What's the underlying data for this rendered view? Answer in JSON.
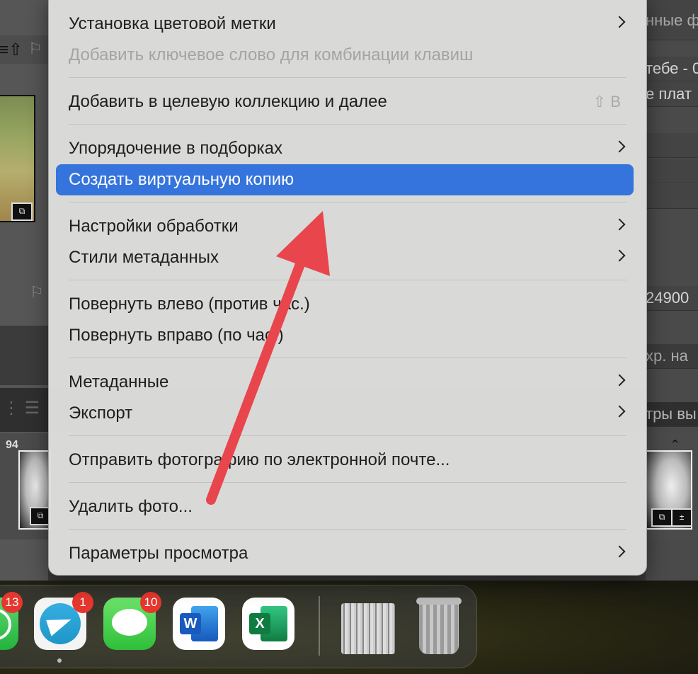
{
  "background": {
    "right_texts": [
      "нные ф",
      "тебе - 0",
      "е плат",
      "24900",
      "хр. на",
      "тры вы"
    ],
    "filmstrip_counter": "94"
  },
  "menu": {
    "items": [
      {
        "label": "Установка цветовой метки",
        "submenu": true,
        "state": "normal"
      },
      {
        "label": "Добавить ключевое слово для комбинации клавиш",
        "state": "disabled"
      },
      {
        "label": "Добавить в целевую коллекцию и далее",
        "shortcut": "⇧ B",
        "state": "normal"
      },
      {
        "label": "Упорядочение в подборках",
        "submenu": true,
        "state": "normal"
      },
      {
        "label": "Создать виртуальную копию",
        "state": "selected"
      },
      {
        "label": "Настройки обработки",
        "submenu": true,
        "state": "normal"
      },
      {
        "label": "Стили метаданных",
        "submenu": true,
        "state": "normal"
      },
      {
        "label": "Повернуть влево (против час.)",
        "state": "normal"
      },
      {
        "label": "Повернуть вправо (по час.)",
        "state": "normal"
      },
      {
        "label": "Метаданные",
        "submenu": true,
        "state": "normal"
      },
      {
        "label": "Экспорт",
        "submenu": true,
        "state": "normal"
      },
      {
        "label": "Отправить фотографию по электронной почте...",
        "state": "normal"
      },
      {
        "label": "Удалить фото...",
        "state": "normal"
      },
      {
        "label": "Параметры просмотра",
        "submenu": true,
        "state": "normal"
      }
    ],
    "selected_color": "#3574dc"
  },
  "annotation": {
    "arrow_color": "#e8454d"
  },
  "dock": {
    "items": [
      {
        "name": "whatsapp",
        "badge": "13"
      },
      {
        "name": "telegram",
        "badge": "1"
      },
      {
        "name": "messages",
        "badge": "10"
      },
      {
        "name": "word",
        "letter": "W"
      },
      {
        "name": "excel",
        "letter": "X"
      },
      {
        "name": "document-stack"
      },
      {
        "name": "trash"
      }
    ]
  }
}
